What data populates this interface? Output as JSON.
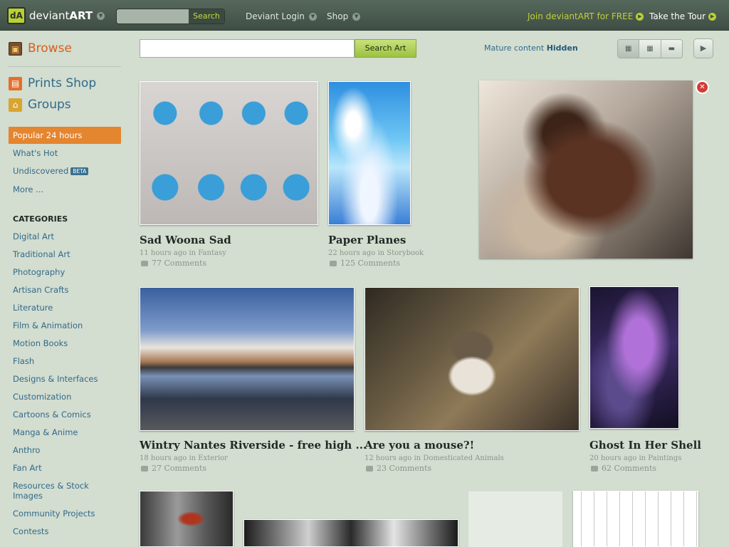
{
  "header": {
    "logo_text_plain": "deviant",
    "logo_text_bold": "ART",
    "logo_mark": "dA",
    "search_placeholder": "",
    "search_label": "Search",
    "nav": [
      "Deviant Login",
      "Shop"
    ],
    "join": "Join deviantART for FREE",
    "tour": "Take the Tour"
  },
  "sidebar": {
    "browse": "Browse",
    "prints": "Prints Shop",
    "groups": "Groups",
    "popular": "Popular 24 hours",
    "links": [
      "What's Hot",
      "Undiscovered",
      "More ..."
    ],
    "beta": "BETA",
    "categories_heading": "CATEGORIES",
    "categories": [
      "Digital Art",
      "Traditional Art",
      "Photography",
      "Artisan Crafts",
      "Literature",
      "Film & Animation",
      "Motion Books",
      "Flash",
      "Designs & Interfaces",
      "Customization",
      "Cartoons & Comics",
      "Manga & Anime",
      "Anthro",
      "Fan Art",
      "Resources & Stock Images",
      "Community Projects",
      "Contests"
    ]
  },
  "toolbar": {
    "search_label": "Search Art",
    "mature_prefix": "Mature content",
    "mature_state": "Hidden"
  },
  "icons": {
    "logo": "deviantart-logo-icon",
    "view_modes": [
      "grid-large-icon",
      "grid-small-icon",
      "list-icon"
    ],
    "play": "play-icon",
    "close": "close-icon"
  },
  "colors": {
    "accent_orange": "#e4852f",
    "link_blue": "#316a8a",
    "search_green": "#9cc13f",
    "logo_green": "#b9d132"
  },
  "deviations": [
    {
      "title": "Sad Woona Sad",
      "time": "11 hours ago in",
      "category": "Fantasy",
      "comments": "77 Comments"
    },
    {
      "title": "Paper Planes",
      "time": "22 hours ago in",
      "category": "Storybook",
      "comments": "125 Comments"
    },
    {
      "title": "Wintry Nantes Riverside - free high ...",
      "time": "18 hours ago in",
      "category": "Exterior",
      "comments": "27 Comments"
    },
    {
      "title": "Are you a mouse?!",
      "time": "12 hours ago in",
      "category": "Domesticated Animals",
      "comments": "23 Comments"
    },
    {
      "title": "Ghost In Her Shell",
      "time": "20 hours ago in",
      "category": "Paintings",
      "comments": "62 Comments"
    }
  ]
}
